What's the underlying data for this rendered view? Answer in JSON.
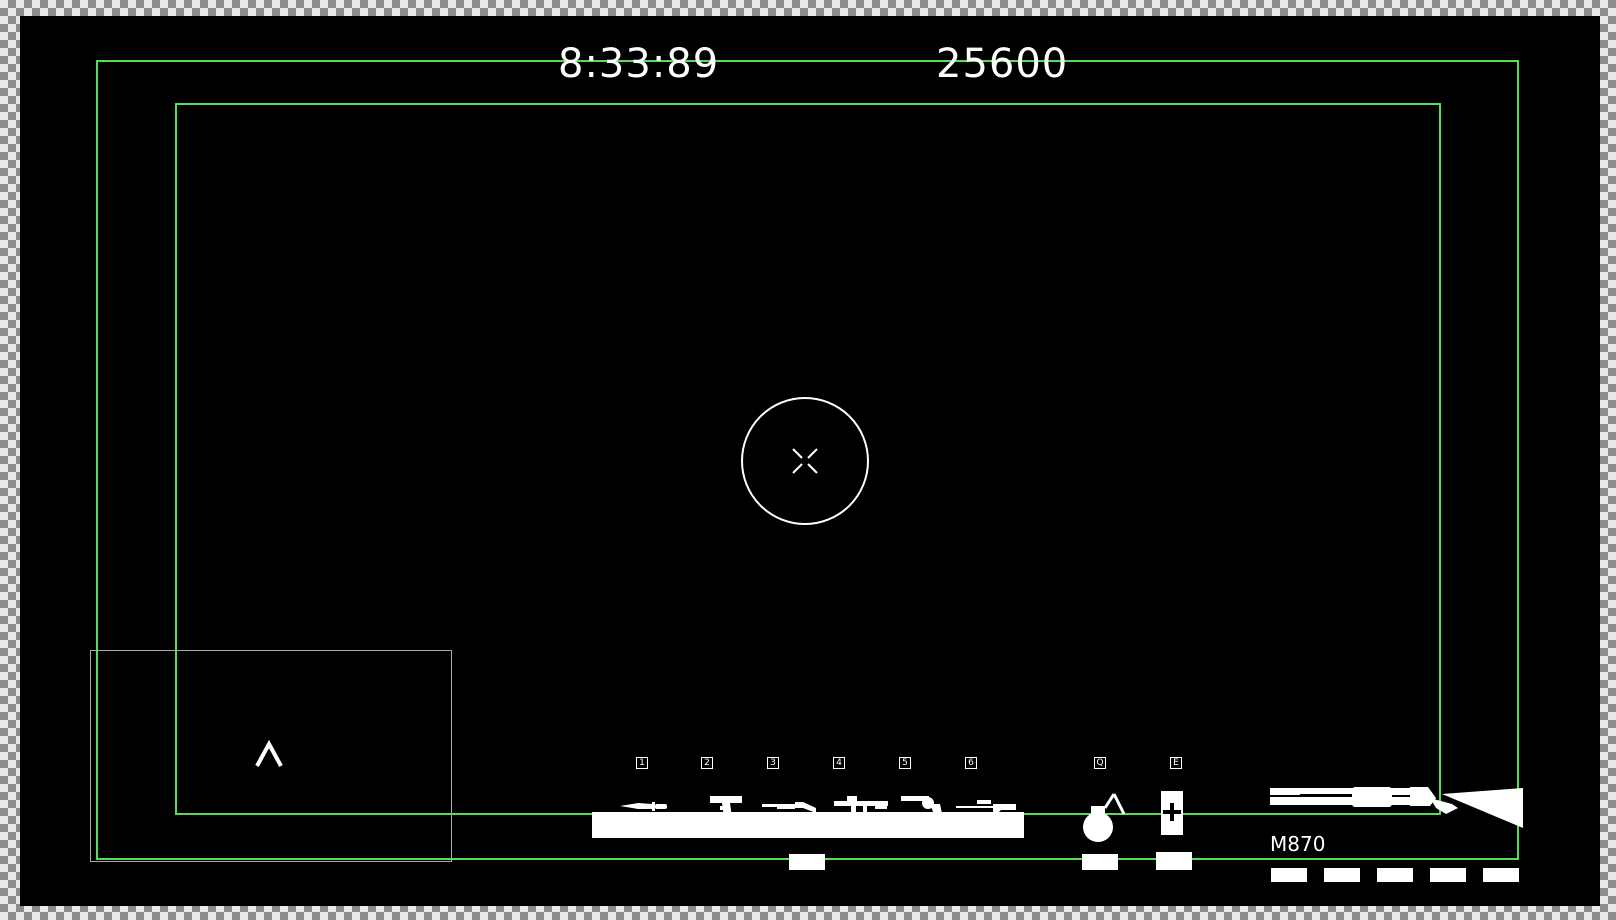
{
  "hud": {
    "timer": "8:33:89",
    "score": "25600"
  },
  "colors": {
    "safe_frame": "#55dd55",
    "hud_white": "#ffffff",
    "background": "#000000",
    "minimap_border": "#a8a8a8"
  },
  "crosshair": {
    "ring_icon": "circle-icon",
    "center_icon": "x-crosshair-icon"
  },
  "minimap": {
    "player_icon": "chevron-up-icon"
  },
  "weapon_slots": [
    {
      "key": "1",
      "icon": "knife-icon"
    },
    {
      "key": "2",
      "icon": "pistol-icon"
    },
    {
      "key": "3",
      "icon": "shotgun-icon"
    },
    {
      "key": "4",
      "icon": "smg-icon"
    },
    {
      "key": "5",
      "icon": "revolver-icon"
    },
    {
      "key": "6",
      "icon": "sniper-rifle-icon"
    }
  ],
  "utility_slots": [
    {
      "key": "Q",
      "icon": "grenade-icon"
    },
    {
      "key": "E",
      "icon": "medkit-icon"
    }
  ],
  "current_weapon": {
    "name": "M870",
    "icon": "pump-shotgun-icon"
  }
}
